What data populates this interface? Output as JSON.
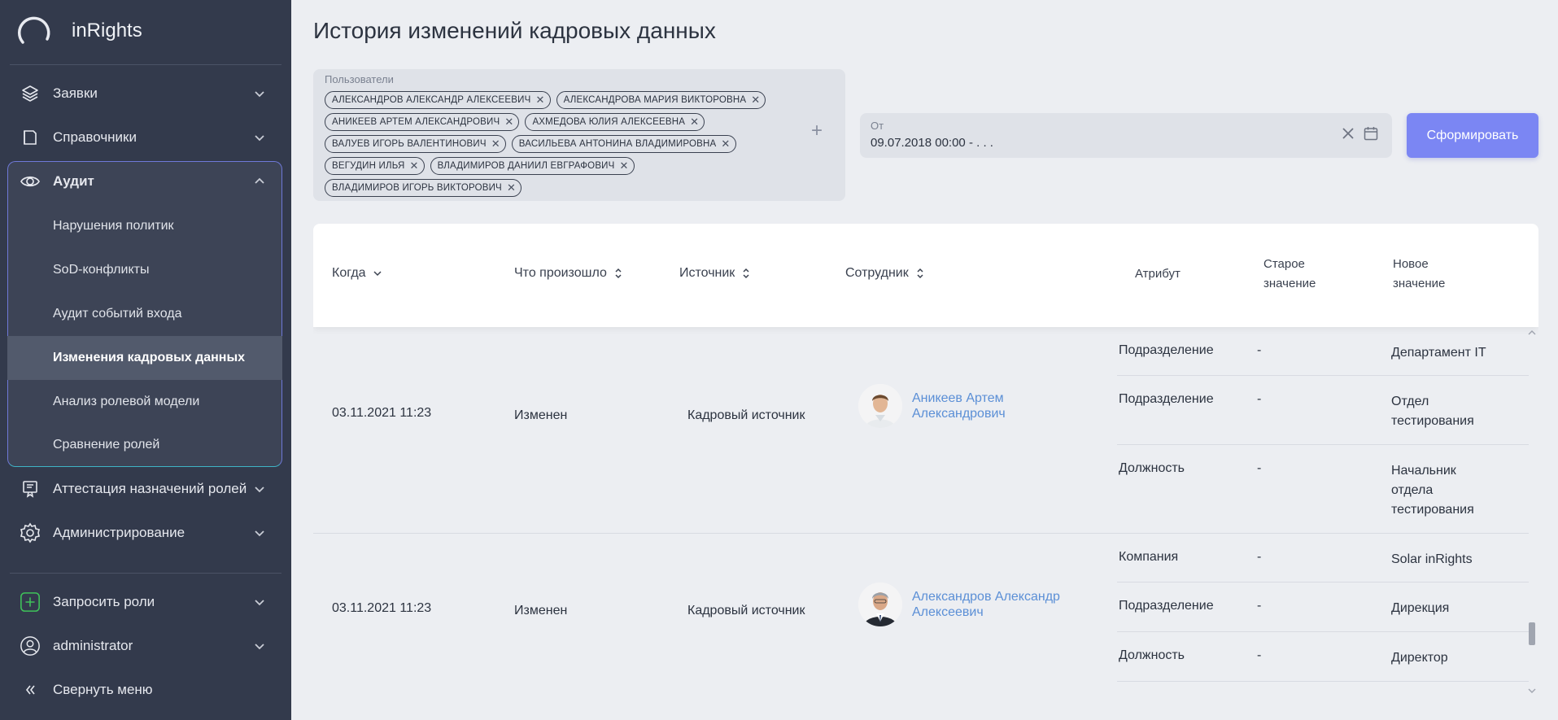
{
  "app": {
    "name": "inRights"
  },
  "sidebar": {
    "items": [
      {
        "label": "Заявки"
      },
      {
        "label": "Справочники"
      },
      {
        "label": "Аудит"
      },
      {
        "label": "Аттестация назначений ролей"
      },
      {
        "label": "Администрирование"
      }
    ],
    "audit_sub": [
      {
        "label": "Нарушения политик"
      },
      {
        "label": "SoD-конфликты"
      },
      {
        "label": "Аудит событий входа"
      },
      {
        "label": "Изменения кадровых данных"
      },
      {
        "label": "Анализ ролевой модели"
      },
      {
        "label": "Сравнение ролей"
      }
    ],
    "request_roles": "Запросить роли",
    "user": "administrator",
    "collapse": "Свернуть меню"
  },
  "page": {
    "title": "История изменений кадровых данных"
  },
  "filters": {
    "users_label": "Пользователи",
    "users": [
      "АЛЕКСАНДРОВ АЛЕКСАНДР АЛЕКСЕЕВИЧ",
      "АЛЕКСАНДРОВА МАРИЯ ВИКТОРОВНА",
      "АНИКЕЕВ АРТЕМ АЛЕКСАНДРОВИЧ",
      "АХМЕДОВА ЮЛИЯ АЛЕКСЕЕВНА",
      "ВАЛУЕВ ИГОРЬ ВАЛЕНТИНОВИЧ",
      "ВАСИЛЬЕВА АНТОНИНА ВЛАДИМИРОВНА",
      "ВЕГУДИН ИЛЬЯ",
      "ВЛАДИМИРОВ ДАНИИЛ ЕВГРАФОВИЧ",
      "ВЛАДИМИРОВ ИГОРЬ ВИКТОРОВИЧ"
    ],
    "date_label": "От",
    "date_value": "09.07.2018 00:00 - . . .",
    "submit": "Сформировать"
  },
  "table": {
    "columns": {
      "when": "Когда",
      "what": "Что произошло",
      "source": "Источник",
      "employee": "Сотрудник",
      "attribute": "Атрибут",
      "old_1": "Старое",
      "old_2": "значение",
      "new_1": "Новое",
      "new_2": "значение"
    },
    "rows": [
      {
        "when": "03.11.2021 11:23",
        "what": "Изменен",
        "source": "Кадровый источник",
        "employee_1": "Аникеев Артем",
        "employee_2": "Александрович",
        "changes": [
          {
            "attr": "Подразделение",
            "old": "-",
            "new": "Департамент IT"
          },
          {
            "attr": "Подразделение",
            "old": "-",
            "new": "Отдел тестирования"
          },
          {
            "attr": "Должность",
            "old": "-",
            "new": "Начальник отдела тестирования"
          }
        ]
      },
      {
        "when": "03.11.2021 11:23",
        "what": "Изменен",
        "source": "Кадровый источник",
        "employee_1": "Александров Александр",
        "employee_2": "Алексеевич",
        "changes": [
          {
            "attr": "Компания",
            "old": "-",
            "new": "Solar inRights"
          },
          {
            "attr": "Подразделение",
            "old": "-",
            "new": "Дирекция"
          },
          {
            "attr": "Должность",
            "old": "-",
            "new": "Директор"
          }
        ]
      }
    ]
  },
  "colors": {
    "sidebar_bg": "#333a4c",
    "accent": "#7b86f3",
    "link": "#5b8fd6",
    "bg": "#eceef2"
  },
  "icons": [
    "layers-icon",
    "book-icon",
    "eye-icon",
    "certificate-icon",
    "gear-icon",
    "plus-square-icon",
    "user-icon",
    "chevrons-left-icon"
  ]
}
